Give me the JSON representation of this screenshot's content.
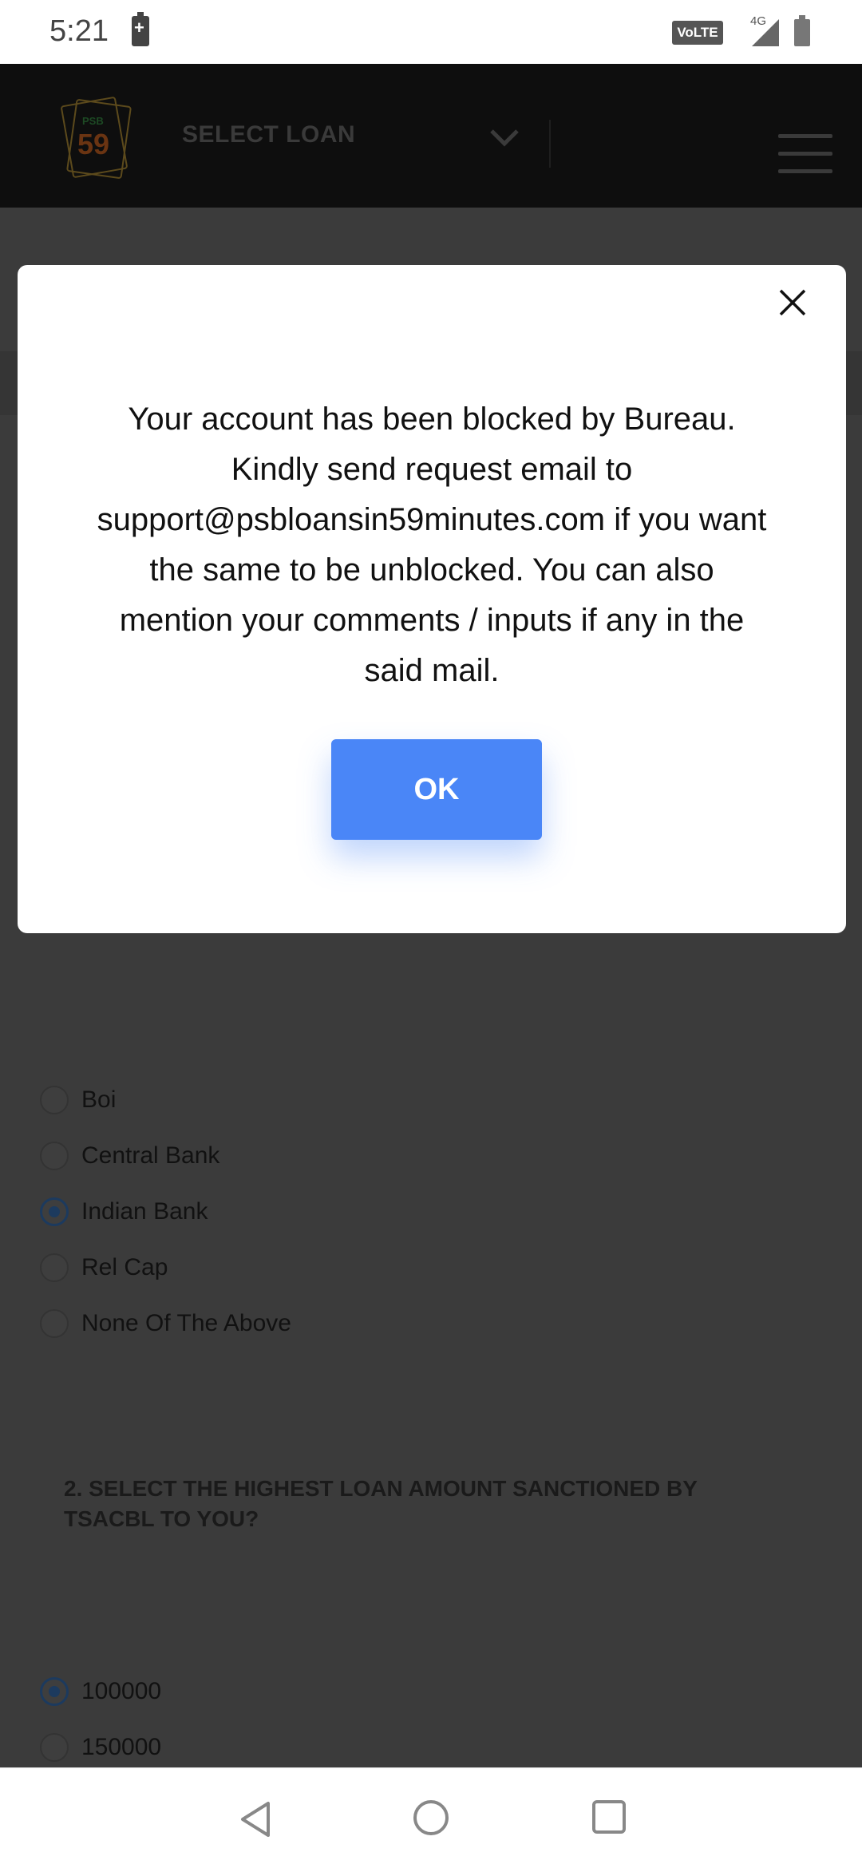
{
  "status_bar": {
    "time": "5:21",
    "volte": "VoLTE",
    "network": "4G"
  },
  "header": {
    "logo_top": "PSB",
    "logo_number": "59",
    "select_label": "SELECT LOAN"
  },
  "question1": {
    "options": [
      {
        "label": "Boi",
        "checked": false
      },
      {
        "label": "Central Bank",
        "checked": false
      },
      {
        "label": "Indian Bank",
        "checked": true
      },
      {
        "label": "Rel Cap",
        "checked": false
      },
      {
        "label": "None Of The Above",
        "checked": false
      }
    ]
  },
  "question2": {
    "title": "2. SELECT THE HIGHEST LOAN AMOUNT SANCTIONED BY TSACBL TO YOU?",
    "options": [
      {
        "label": "100000",
        "checked": true
      },
      {
        "label": "150000",
        "checked": false
      }
    ]
  },
  "modal": {
    "message": "Your account has been blocked by Bureau. Kindly send request email to support@psbloansin59minutes.com if you want the same to be unblocked. You can also mention your comments / inputs if any in the said mail.",
    "ok_label": "OK"
  },
  "colors": {
    "accent": "#4a86f7",
    "overlay": "#3b3b3b",
    "header_bg": "#0e0e0e"
  }
}
